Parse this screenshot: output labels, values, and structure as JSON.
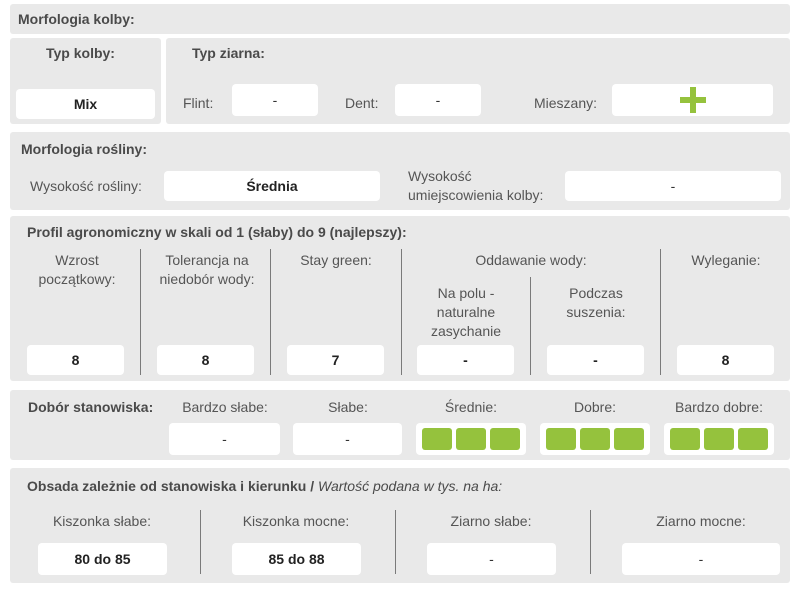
{
  "morfologia_kolby": {
    "title": "Morfologia kolby:",
    "typ_kolby": {
      "label": "Typ kolby:",
      "value": "Mix"
    },
    "typ_ziarna": {
      "label": "Typ ziarna:",
      "flint_label": "Flint:",
      "flint_value": "-",
      "dent_label": "Dent:",
      "dent_value": "-",
      "mieszany_label": "Mieszany:",
      "mieszany_icon": "plus-icon",
      "accent_color": "#95c23d"
    }
  },
  "morfologia_rosliny": {
    "title": "Morfologia rośliny:",
    "wysokosc_label": "Wysokość rośliny:",
    "wysokosc_value": "Średnia",
    "kolba_label_1": "Wysokość",
    "kolba_label_2": "umiejscowienia kolby:",
    "kolba_value": "-"
  },
  "profil": {
    "title": "Profil agronomiczny w skali od 1 (słaby) do 9 (najlepszy):",
    "wzrost_label": "Wzrost początkowy:",
    "wzrost_value": "8",
    "tolerancja_label": "Tolerancja na niedobór wody:",
    "tolerancja_value": "8",
    "stay_label": "Stay green:",
    "stay_value": "7",
    "oddawanie_label": "Oddawanie wody:",
    "na_polu_label": "Na polu - naturalne zasychanie",
    "na_polu_value": "-",
    "podczas_label": "Podczas suszenia:",
    "podczas_value": "-",
    "wyleganie_label": "Wyleganie:",
    "wyleganie_value": "8"
  },
  "dobor": {
    "title": "Dobór stanowiska:",
    "bardzo_slabe_label": "Bardzo słabe:",
    "bardzo_slabe_value": "-",
    "slabe_label": "Słabe:",
    "slabe_value": "-",
    "srednie_label": "Średnie:",
    "srednie_level": 3,
    "dobre_label": "Dobre:",
    "dobre_level": 3,
    "bardzo_dobre_label": "Bardzo dobre:",
    "bardzo_dobre_level": 3
  },
  "obsada": {
    "title": "Obsada zależnie od stanowiska i kierunku",
    "subtitle": "Wartość podana w tys. na ha:",
    "kiszonka_slabe_label": "Kiszonka słabe:",
    "kiszonka_slabe_value": "80 do 85",
    "kiszonka_mocne_label": "Kiszonka mocne:",
    "kiszonka_mocne_value": "85 do 88",
    "ziarno_slabe_label": "Ziarno słabe:",
    "ziarno_slabe_value": "-",
    "ziarno_mocne_label": "Ziarno mocne:",
    "ziarno_mocne_value": "-"
  }
}
